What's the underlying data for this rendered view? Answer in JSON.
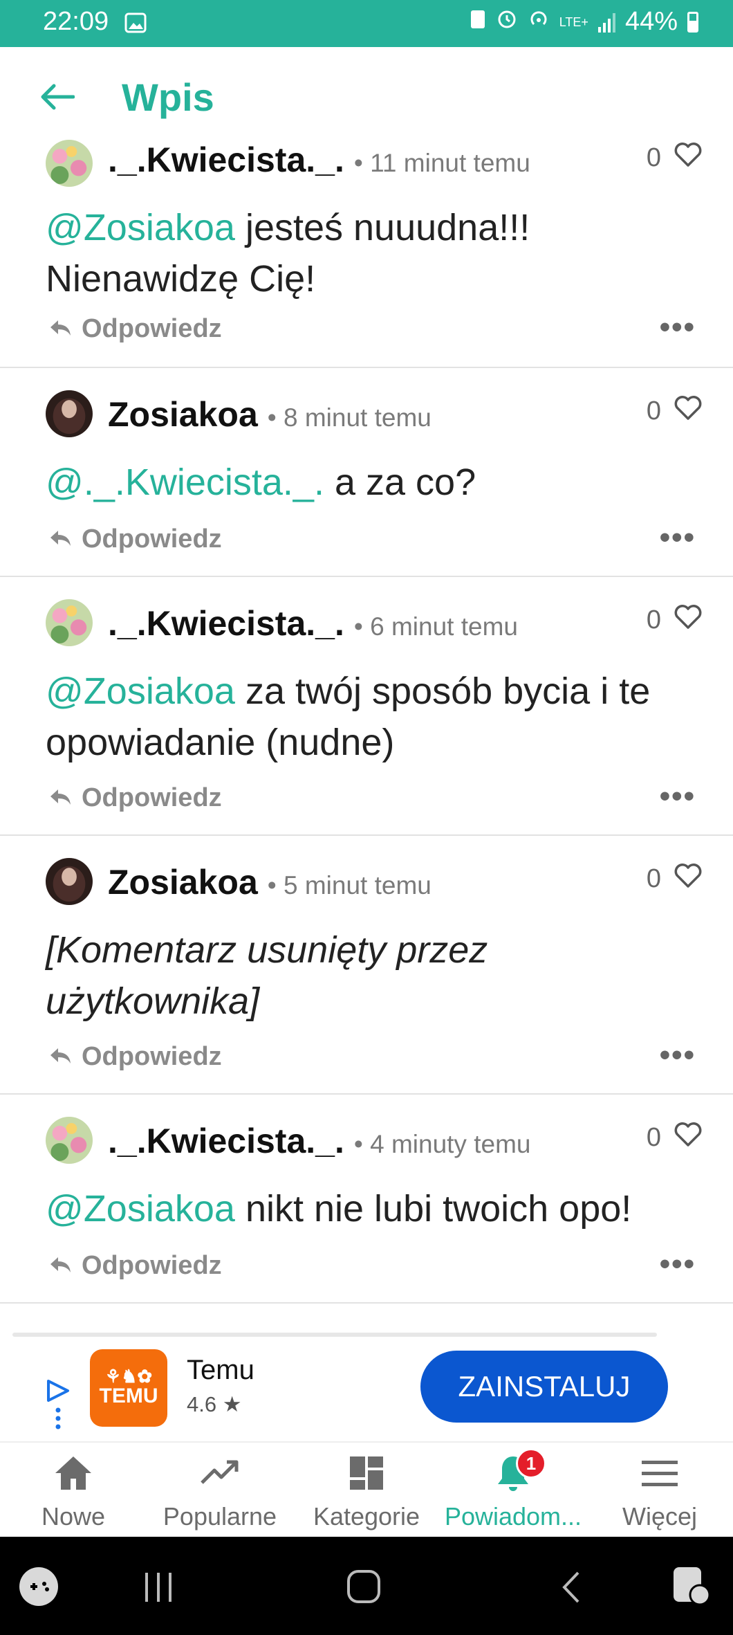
{
  "status_bar": {
    "time": "22:09",
    "battery": "44%",
    "network": "LTE+"
  },
  "app_bar": {
    "title": "Wpis"
  },
  "comments": [
    {
      "author": "._.Kwiecista._.",
      "time": "11 minut temu",
      "likes": "0",
      "mention": "@Zosiakoa",
      "text": " jesteś nuuudna!!! Nienawidzę Cię!",
      "reply": "Odpowiedz",
      "more": "•••"
    },
    {
      "author": "Zosiakoa",
      "time": "8 minut temu",
      "likes": "0",
      "mention": "@._.Kwiecista._.",
      "text": " a za co?",
      "reply": "Odpowiedz",
      "more": "•••"
    },
    {
      "author": "._.Kwiecista._.",
      "time": "6 minut temu",
      "likes": "0",
      "mention": "@Zosiakoa",
      "text": " za twój sposób bycia i te opowiadanie (nudne)",
      "reply": "Odpowiedz",
      "more": "•••"
    },
    {
      "author": "Zosiakoa",
      "time": "5 minut temu",
      "likes": "0",
      "text": "[Komentarz usunięty przez użytkownika]",
      "reply": "Odpowiedz",
      "more": "•••"
    },
    {
      "author": "._.Kwiecista._.",
      "time": "4 minuty temu",
      "likes": "0",
      "mention": "@Zosiakoa",
      "text": " nikt nie lubi twoich opo!",
      "reply": "Odpowiedz",
      "more": "•••"
    }
  ],
  "ad": {
    "app_name": "Temu",
    "rating": "4.6 ★",
    "logo_top": "⚘♞✿",
    "logo_text": "TEMU",
    "install_label": "ZAINSTALUJ"
  },
  "bottom_nav": [
    {
      "label": "Nowe",
      "icon": "home-icon"
    },
    {
      "label": "Popularne",
      "icon": "trending-icon"
    },
    {
      "label": "Kategorie",
      "icon": "categories-icon"
    },
    {
      "label": "Powiadom...",
      "icon": "bell-icon",
      "badge": "1",
      "active": true
    },
    {
      "label": "Więcej",
      "icon": "menu-icon"
    }
  ],
  "colors": {
    "accent": "#26b29a",
    "ad_button": "#0b57d0",
    "temu_orange": "#f46d0c",
    "badge": "#e41e2a"
  }
}
